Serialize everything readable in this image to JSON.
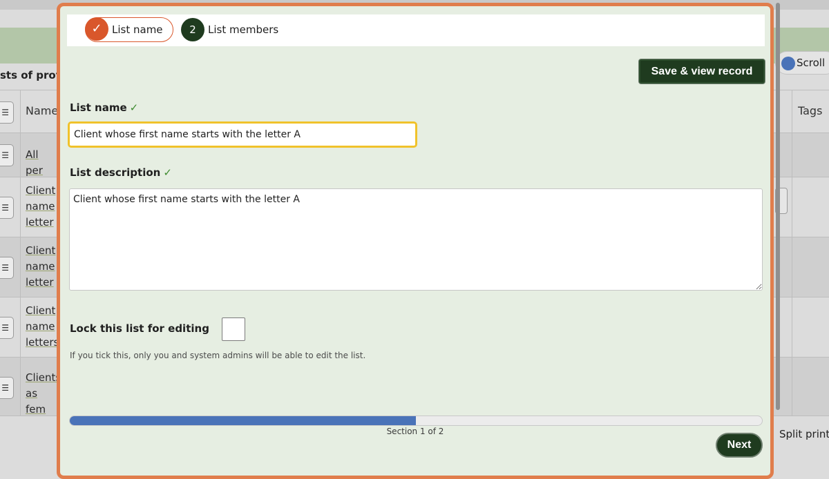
{
  "background": {
    "page_title_fragment": "sts of profi",
    "column_name": "Name",
    "column_tags": "Tags",
    "scroll_label": "Scroll",
    "split_label": "Split print",
    "rows": [
      {
        "link": "All per"
      },
      {
        "link": "Client\nname\nletter"
      },
      {
        "link": "Client\nname\nletter"
      },
      {
        "link": "Client\nname\nletters"
      },
      {
        "link": "Clients\nas fem"
      }
    ]
  },
  "modal": {
    "steps": [
      {
        "number": "✓",
        "label": "List name",
        "state": "current"
      },
      {
        "number": "2",
        "label": "List members",
        "state": "pending"
      }
    ],
    "save_button": "Save & view record",
    "list_name": {
      "label": "List name",
      "check": "✓",
      "value": "Client whose first name starts with the letter A"
    },
    "list_description": {
      "label": "List description",
      "check": "✓",
      "value": "Client whose first name starts with the letter A"
    },
    "lock": {
      "label": "Lock this list for editing",
      "checked": false,
      "help": "If you tick this, only you and system admins will be able to edit the list."
    },
    "progress": {
      "fraction": 0.5,
      "label": "Section 1 of 2"
    },
    "next_button": "Next"
  },
  "colors": {
    "accent_orange": "#e07d4c",
    "primary_dark_green": "#1f3b1f",
    "progress_blue": "#4a73b8",
    "focus_yellow": "#f0c22b",
    "check_green": "#3d8a2e"
  }
}
